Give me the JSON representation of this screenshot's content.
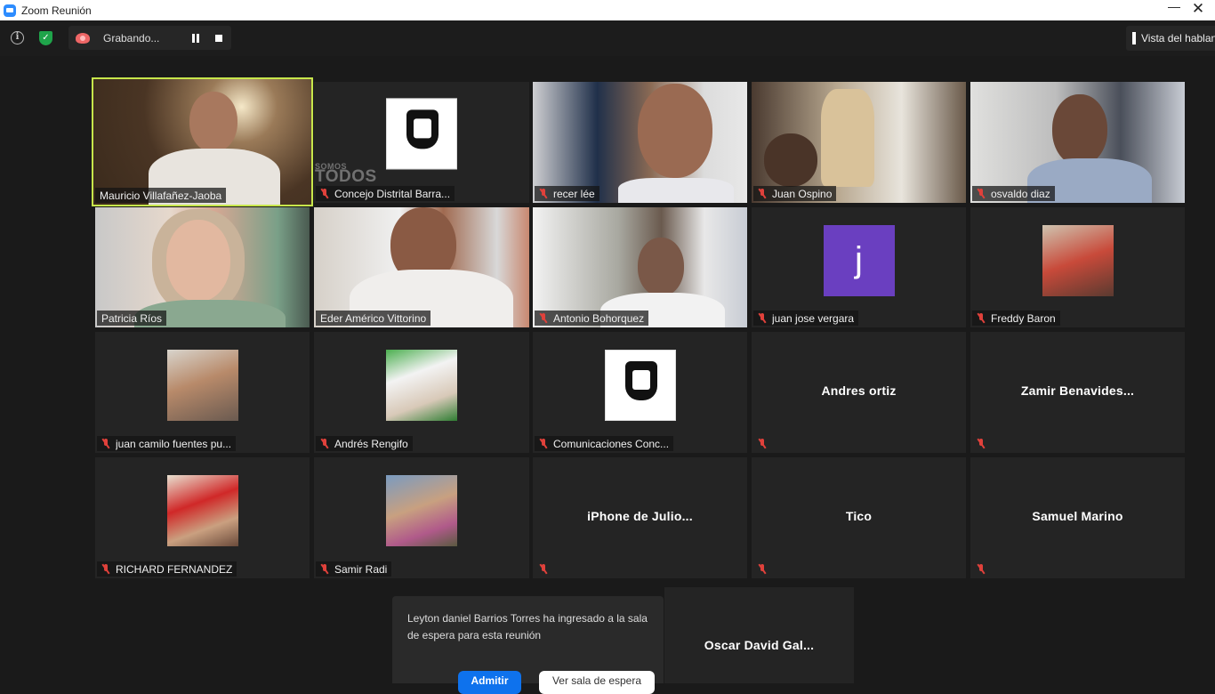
{
  "window": {
    "title": "Zoom Reunión",
    "minimize_label": "—",
    "close_label": "✕"
  },
  "topbar": {
    "info_label": "i",
    "shield_label": "✓",
    "recording_text": "Grabando...",
    "view_label": "Vista del hablante"
  },
  "participants": [
    {
      "name": "Mauricio Villafañez-Jaoba",
      "type": "video",
      "muted": false,
      "active_speaker": true
    },
    {
      "name": "Concejo Distrital Barra...",
      "type": "logo",
      "muted": true,
      "watermark_small": "SOMOS",
      "watermark": "TODOS"
    },
    {
      "name": "recer lée",
      "type": "video",
      "muted": true
    },
    {
      "name": "Juan Ospino",
      "type": "video",
      "muted": true
    },
    {
      "name": "osvaldo diaz",
      "type": "video",
      "muted": true
    },
    {
      "name": "Patricia Ríos",
      "type": "video",
      "muted": false
    },
    {
      "name": "Eder Américo Vittorino",
      "type": "video",
      "muted": false
    },
    {
      "name": "Antonio Bohorquez",
      "type": "video",
      "muted": true
    },
    {
      "name": "juan jose vergara",
      "type": "letter",
      "letter": "j",
      "muted": true,
      "avatar_color": "#6a3fc0"
    },
    {
      "name": "Freddy Baron",
      "type": "photo",
      "muted": true
    },
    {
      "name": "juan camilo fuentes pu...",
      "type": "photo",
      "muted": true
    },
    {
      "name": "Andrés Rengifo",
      "type": "photo",
      "muted": true
    },
    {
      "name": "Comunicaciones Conc...",
      "type": "logo",
      "muted": true
    },
    {
      "name": "Andres ortiz",
      "type": "name",
      "muted": true
    },
    {
      "name": "Zamir Benavides...",
      "type": "name",
      "muted": true
    },
    {
      "name": "RICHARD FERNANDEZ",
      "type": "photo",
      "muted": true
    },
    {
      "name": "Samir Radi",
      "type": "photo",
      "muted": true
    },
    {
      "name": "iPhone de Julio...",
      "type": "name",
      "muted": true
    },
    {
      "name": "Tico",
      "type": "name",
      "muted": true
    },
    {
      "name": "Samuel Marino",
      "type": "name",
      "muted": true
    },
    {
      "name": "Oscar David Gal...",
      "type": "name",
      "muted": false
    }
  ],
  "waiting_room_notice": {
    "message": "Leyton daniel Barrios Torres ha ingresado a la sala de espera para esta reunión",
    "admit_label": "Admitir",
    "view_waiting_room_label": "Ver sala de espera"
  },
  "colors": {
    "active_speaker": "#c7e64b",
    "mic_off": "#e0413b",
    "admit_button": "#0e72ed",
    "background": "#1a1a1a"
  }
}
